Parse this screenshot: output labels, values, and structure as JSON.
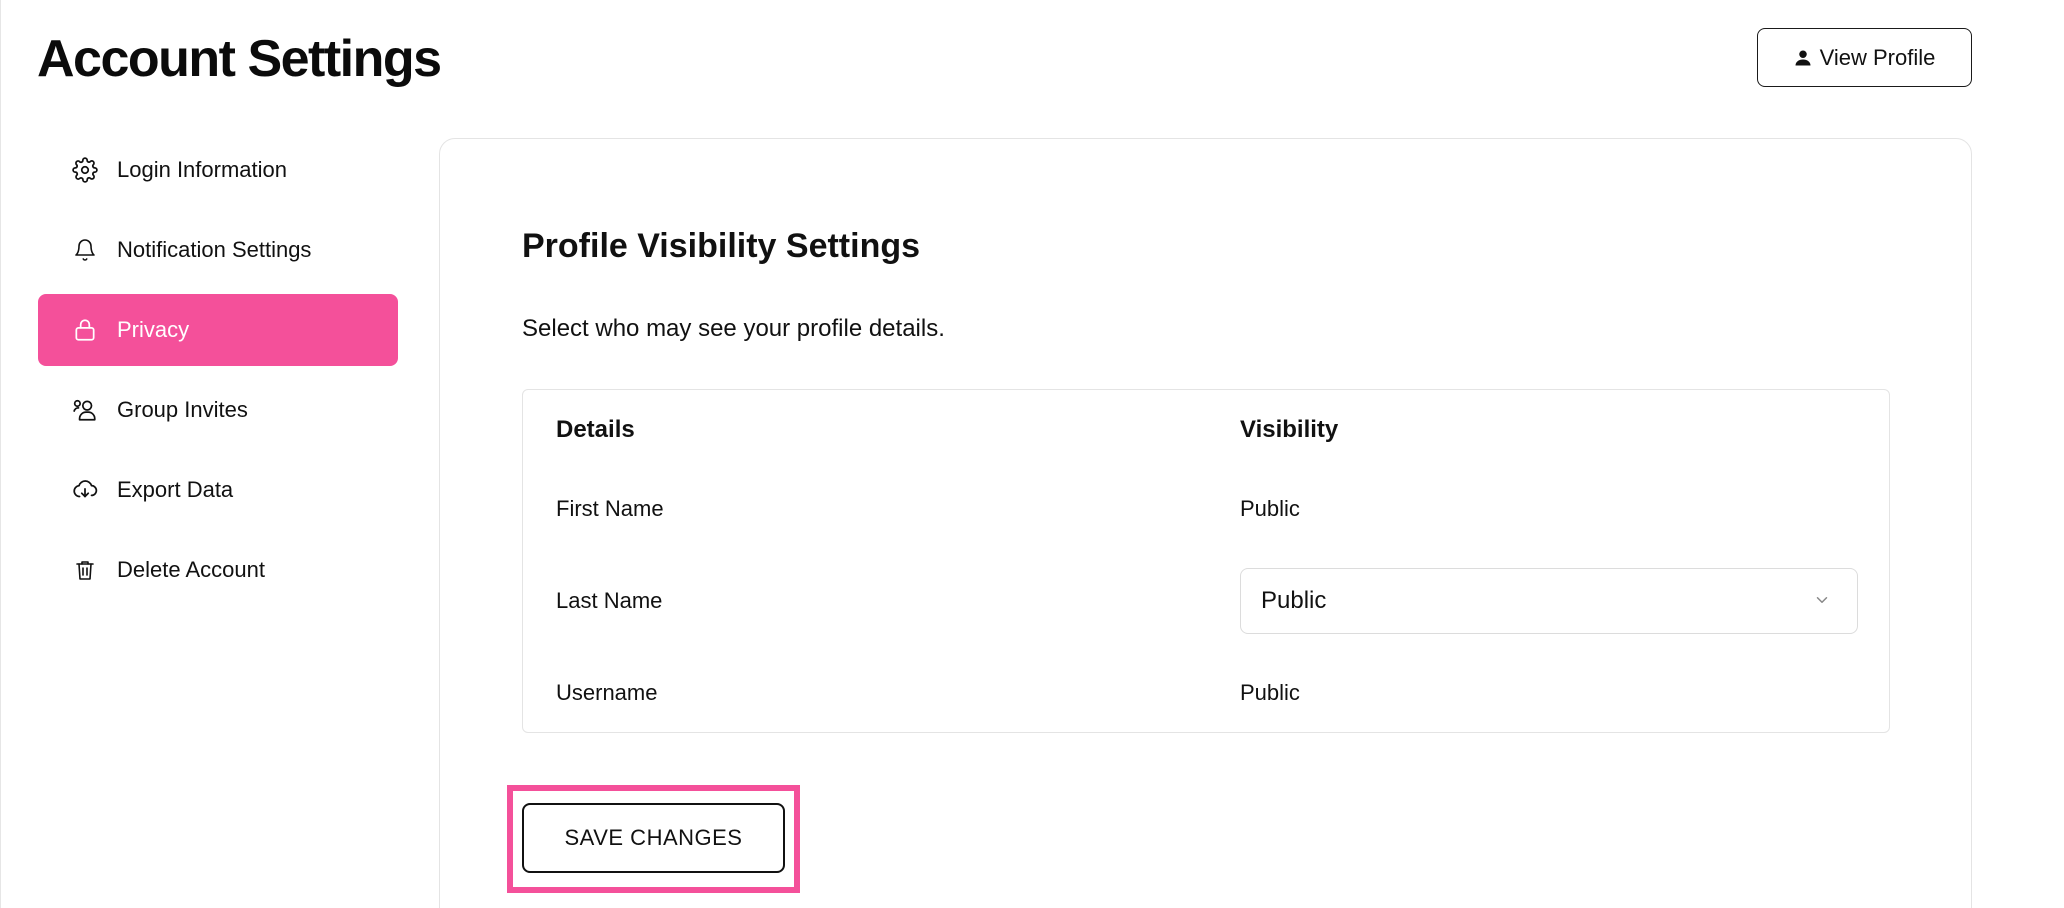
{
  "header": {
    "title": "Account Settings",
    "view_profile_label": "View Profile"
  },
  "sidebar": {
    "items": [
      {
        "label": "Login Information",
        "icon": "gear-icon"
      },
      {
        "label": "Notification Settings",
        "icon": "bell-icon"
      },
      {
        "label": "Privacy",
        "icon": "lock-icon",
        "active": true
      },
      {
        "label": "Group Invites",
        "icon": "users-icon"
      },
      {
        "label": "Export Data",
        "icon": "cloud-download-icon"
      },
      {
        "label": "Delete Account",
        "icon": "trash-icon"
      }
    ]
  },
  "main": {
    "title": "Profile Visibility Settings",
    "description": "Select who may see your profile details.",
    "table": {
      "headers": [
        "Details",
        "Visibility"
      ],
      "rows": [
        {
          "detail": "First Name",
          "visibility": "Public"
        },
        {
          "detail": "Last Name",
          "visibility": "Public"
        },
        {
          "detail": "Username",
          "visibility": "Public"
        }
      ]
    },
    "save_label": "SAVE CHANGES"
  },
  "colors": {
    "accent": "#f4509a",
    "text": "#111111",
    "border": "#e4e4e4"
  }
}
